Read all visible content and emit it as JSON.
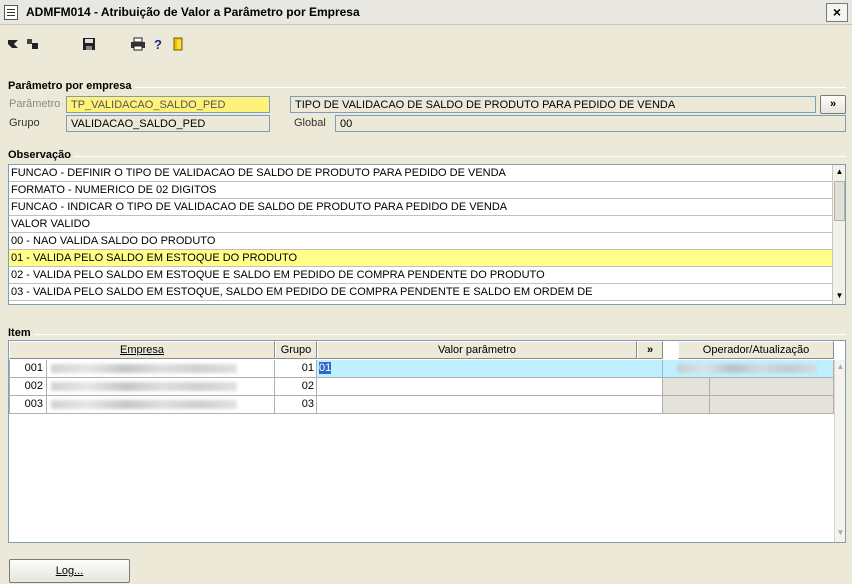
{
  "window": {
    "title": "ADMFM014 - Atribuição de Valor a Parâmetro por Empresa",
    "close_label": "×"
  },
  "toolbar": {
    "icons": [
      "first-record-icon",
      "previous-record-icon",
      "save-icon",
      "print-icon",
      "help-icon",
      "exit-icon"
    ],
    "help_label": "?"
  },
  "parametro": {
    "section_title": "Parâmetro por empresa",
    "parametro_label": "Parâmetro",
    "parametro_value": "TP_VALIDACAO_SALDO_PED",
    "descricao_value": "TIPO DE VALIDACAO DE SALDO DE PRODUTO PARA PEDIDO DE VENDA",
    "expand_label": "»",
    "grupo_label": "Grupo",
    "grupo_value": "VALIDACAO_SALDO_PED",
    "global_label": "Global",
    "global_value": "00"
  },
  "observacao": {
    "section_title": "Observação",
    "lines": [
      "FUNCAO - DEFINIR O TIPO DE VALIDACAO DE SALDO DE PRODUTO PARA PEDIDO DE VENDA",
      "FORMATO - NUMERICO DE 02 DIGITOS",
      "FUNCAO - INDICAR O TIPO DE VALIDACAO DE SALDO DE PRODUTO PARA PEDIDO DE VENDA",
      "VALOR VALIDO",
      "00 - NAO VALIDA SALDO DO PRODUTO",
      "01 - VALIDA PELO SALDO EM ESTOQUE DO PRODUTO",
      "02 - VALIDA PELO SALDO EM ESTOQUE E SALDO EM PEDIDO DE COMPRA PENDENTE DO PRODUTO",
      "03 - VALIDA PELO SALDO EM ESTOQUE, SALDO EM PEDIDO DE COMPRA PENDENTE  E SALDO EM ORDEM DE"
    ],
    "highlight_color": "#ffff8a"
  },
  "item": {
    "section_title": "Item",
    "columns": {
      "empresa": "Empresa",
      "grupo": "Grupo",
      "valor": "Valor parâmetro",
      "expand": "»",
      "operador": "Operador/Atualização"
    },
    "rows": [
      {
        "empresa_code": "001",
        "grupo": "01",
        "valor": "01"
      },
      {
        "empresa_code": "002",
        "grupo": "02",
        "valor": ""
      },
      {
        "empresa_code": "003",
        "grupo": "03",
        "valor": ""
      }
    ],
    "selected_color": "#bff0ff"
  },
  "footer": {
    "log_label": "Log..."
  },
  "colors": {
    "window_bg": "#ece9d8",
    "field_highlight": "#fff27a",
    "field_border": "#7f9db9"
  }
}
